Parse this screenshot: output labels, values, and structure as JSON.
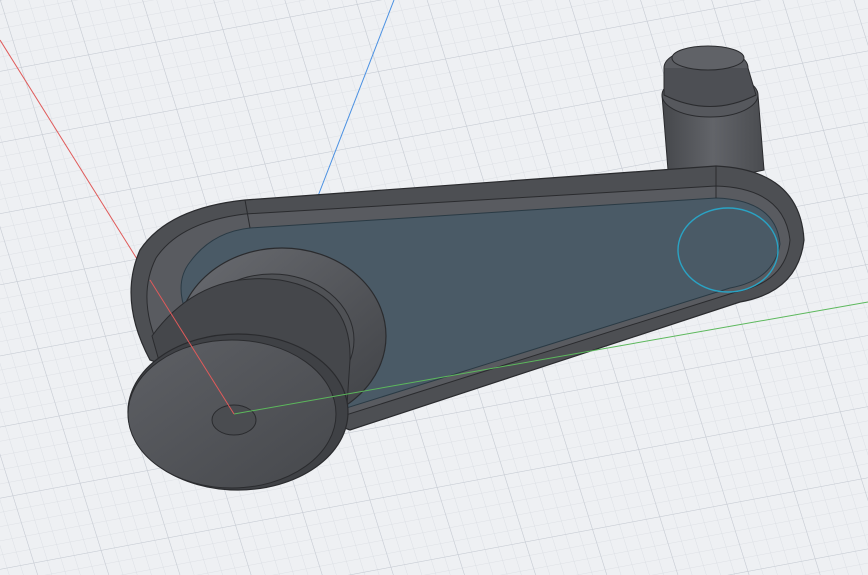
{
  "viewport": {
    "background": "#eef0f3",
    "grid_minor_color": "#d7dbe1",
    "grid_major_color": "#c7ccd4",
    "axis_x_color": "#5cb85c",
    "axis_y_color": "#e05a5a",
    "axis_z_color": "#4a90e2"
  },
  "model": {
    "body_color": "#55575c",
    "edge_color": "#2a2b2e",
    "selected_face_color": "#4a5a66",
    "selection_outline_color": "#2aa3c4",
    "shading": "shaded-with-edges",
    "selection_state": "face-selected"
  }
}
